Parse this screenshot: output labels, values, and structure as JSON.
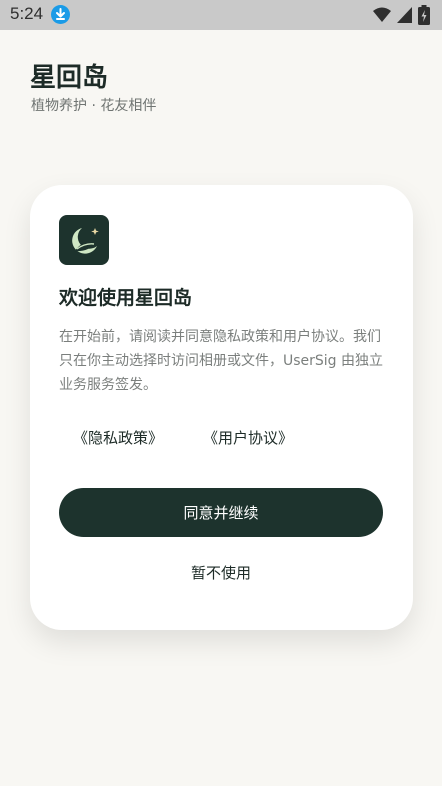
{
  "status_bar": {
    "time": "5:24",
    "icons": [
      "download-icon",
      "wifi-icon",
      "signal-icon",
      "battery-icon"
    ]
  },
  "header": {
    "title": "星回岛",
    "subtitle": "植物养护 · 花友相伴"
  },
  "consent_card": {
    "logo_icon": "leaf-moon-logo-icon",
    "title": "欢迎使用星回岛",
    "body": "在开始前，请阅读并同意隐私政策和用户协议。我们只在你主动选择时访问相册或文件，UserSig 由独立业务服务签发。",
    "privacy_link": "《隐私政策》",
    "terms_link": "《用户协议》",
    "agree_label": "同意并继续",
    "decline_label": "暂不使用"
  },
  "colors": {
    "primary": "#1d332d",
    "background": "#f8f7f3",
    "card": "#ffffff",
    "muted_text": "#7b7f7d",
    "download_badge": "#1a9be7",
    "logo_accent": "#cfe7c4"
  }
}
